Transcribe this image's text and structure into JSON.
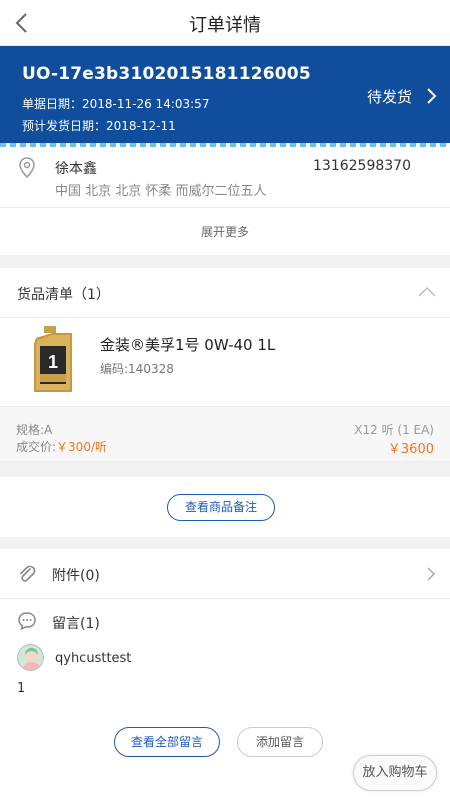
{
  "header": {
    "title": "订单详情"
  },
  "order": {
    "number": "UO-17e3b3102015181126005",
    "doc_date": "单据日期：2018-11-26 14:03:57",
    "ship_date": "预计发货日期：2018-12-11",
    "status": "待发货",
    "colors": {
      "band": "#104d9c"
    }
  },
  "address": {
    "name": "徐本鑫",
    "phone": "13162598370",
    "location": "中国 北京 北京 怀柔 而威尔二位五人",
    "expand_label": "展开更多"
  },
  "goods": {
    "header": "货品清单（1）",
    "items": [
      {
        "name": "金装®美孚1号 0W-40 1L",
        "code": "编码:140328",
        "spec": "规格:A",
        "price_label": "成交价:",
        "price": "￥300/听",
        "qty": "X12 听 (1 EA)",
        "total": "￥3600"
      }
    ],
    "note_button": "查看商品备注"
  },
  "attachments": {
    "label": "附件(0)"
  },
  "messages": {
    "label": "留言(1)",
    "items": [
      {
        "user": "qyhcusttest",
        "text": "1"
      }
    ],
    "view_all": "查看全部留言",
    "add": "添加留言"
  },
  "cart_button": "放入购物车",
  "icons": [
    "back-arrow-icon",
    "chevron-right-icon",
    "location-pin-icon",
    "chevron-up-icon",
    "paperclip-icon",
    "speech-bubble-icon"
  ]
}
